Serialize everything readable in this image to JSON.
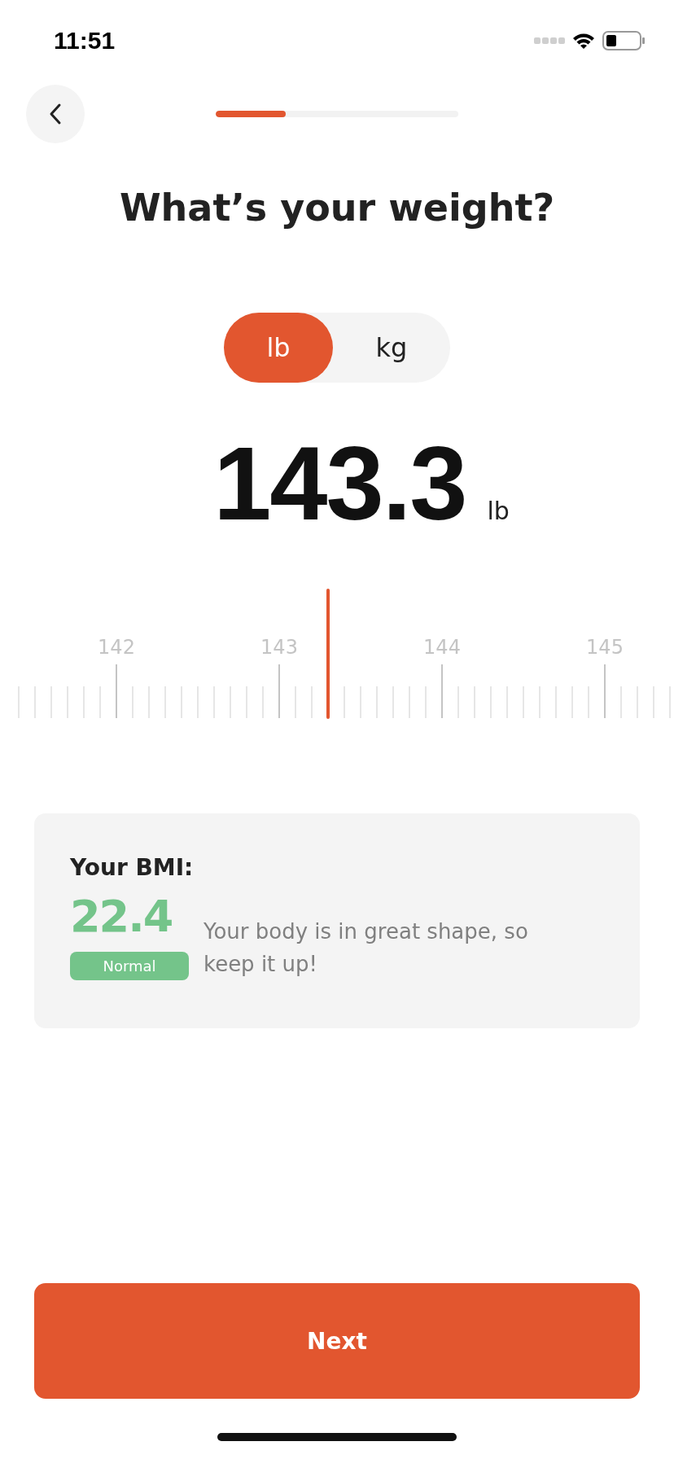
{
  "status_bar": {
    "time": "11:51"
  },
  "progress": {
    "level": 0.29
  },
  "title": "What’s your weight?",
  "units": [
    {
      "label": "lb",
      "selected": true
    },
    {
      "label": "kg",
      "selected": false
    }
  ],
  "weight": {
    "value": "143.3",
    "unit": "lb"
  },
  "ruler": {
    "labels": [
      "142",
      "143",
      "144",
      "145"
    ]
  },
  "bmi": {
    "heading": "Your BMI:",
    "value": "22.4",
    "category": "Normal",
    "color": "#74c48a",
    "message": "Your body is in great shape, so keep it up!"
  },
  "next_button": "Next"
}
